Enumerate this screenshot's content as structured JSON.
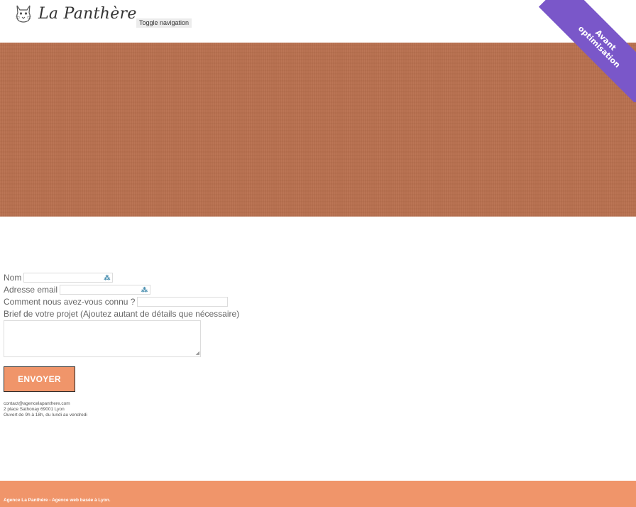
{
  "header": {
    "brand": "La Panthère",
    "logo_icon": "panther-head-icon",
    "toggle_label": "Toggle navigation"
  },
  "ribbon": {
    "line1": "Avant",
    "line2": "optimisation",
    "color": "#7a57c9"
  },
  "hero": {
    "color": "#b9714f"
  },
  "form": {
    "name_label": "Nom",
    "email_label": "Adresse email",
    "source_label": "Comment nous avez-vous connu ?",
    "brief_label": "Brief de votre projet (Ajoutez autant de détails que nécessaire)",
    "name_value": "",
    "email_value": "",
    "source_value": "",
    "brief_value": "",
    "autofill_icon": "autofill-key-icon",
    "submit_label": "ENVOYER"
  },
  "contact": {
    "email": "contact@agencelapanthere.com",
    "address": "2 place Sathonay 69001 Lyon",
    "hours": "Ouvert de 9h à 18h, du lundi au vendredi"
  },
  "footer": {
    "text": "Agence La Panthère - Agence web basée à Lyon.",
    "color": "#f0956a"
  }
}
